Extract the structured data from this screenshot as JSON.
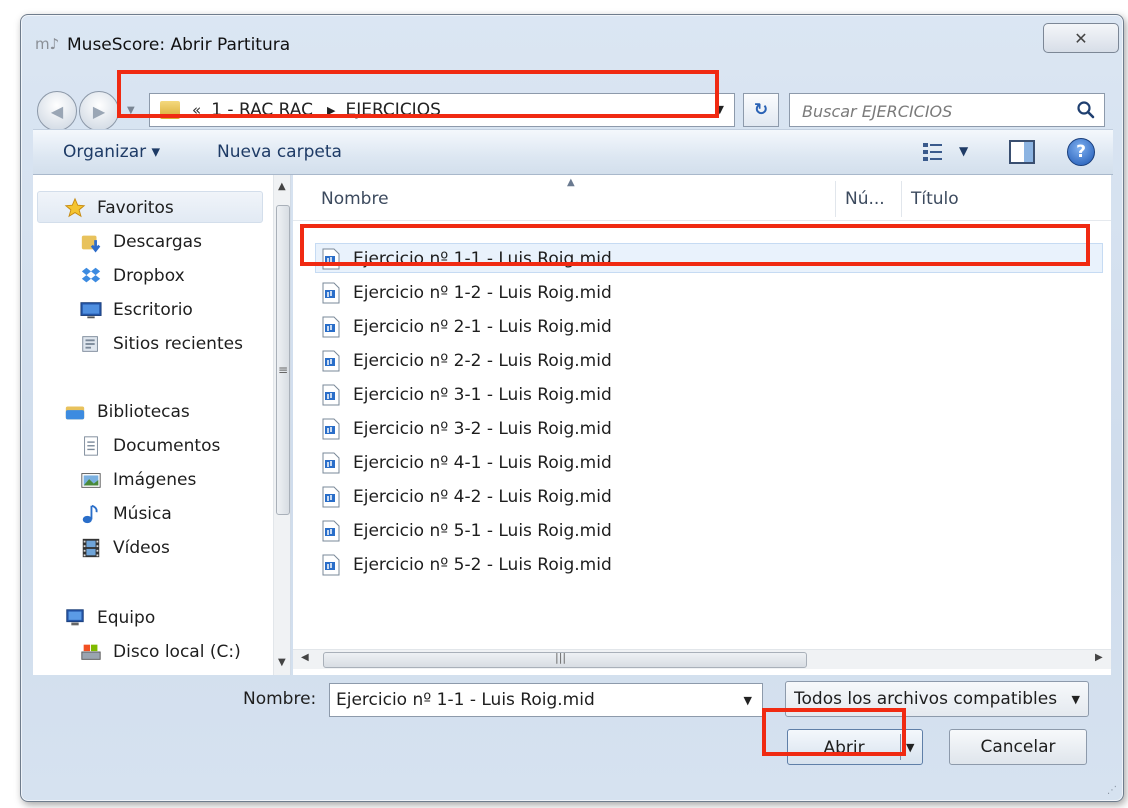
{
  "window": {
    "title": "MuseScore: Abrir Partitura",
    "close_glyph": "✕"
  },
  "address": {
    "overflow_glyph": "«",
    "crumbs": [
      "1 - RAC RAC",
      "EJERCICIOS"
    ]
  },
  "search": {
    "placeholder": "Buscar EJERCICIOS"
  },
  "toolbar": {
    "organize_label": "Organizar ▾",
    "new_folder_label": "Nueva carpeta",
    "help_glyph": "?"
  },
  "nav": {
    "favorites": "Favoritos",
    "favorite_items": [
      "Descargas",
      "Dropbox",
      "Escritorio",
      "Sitios recientes"
    ],
    "libraries": "Bibliotecas",
    "library_items": [
      "Documentos",
      "Imágenes",
      "Música",
      "Vídeos"
    ],
    "computer": "Equipo",
    "computer_items": [
      "Disco local (C:)"
    ]
  },
  "columns": {
    "name": "Nombre",
    "number": "Nú...",
    "title": "Título"
  },
  "files": [
    "Ejercicio nº 1-1 - Luis Roig.mid",
    "Ejercicio nº 1-2 - Luis Roig.mid",
    "Ejercicio nº 2-1 - Luis Roig.mid",
    "Ejercicio nº 2-2 - Luis Roig.mid",
    "Ejercicio nº 3-1 - Luis Roig.mid",
    "Ejercicio nº 3-2 - Luis Roig.mid",
    "Ejercicio nº 4-1 - Luis Roig.mid",
    "Ejercicio nº 4-2 - Luis Roig.mid",
    "Ejercicio nº 5-1 - Luis Roig.mid",
    "Ejercicio nº 5-2 - Luis Roig.mid"
  ],
  "footer": {
    "name_label": "Nombre:",
    "name_value": "Ejercicio nº 1-1 - Luis Roig.mid",
    "filter_value": "Todos los archivos compatibles",
    "open_label": "Abrir",
    "cancel_label": "Cancelar"
  },
  "colors": {
    "highlight": "#f02a12",
    "accent": "#1d57b3"
  }
}
